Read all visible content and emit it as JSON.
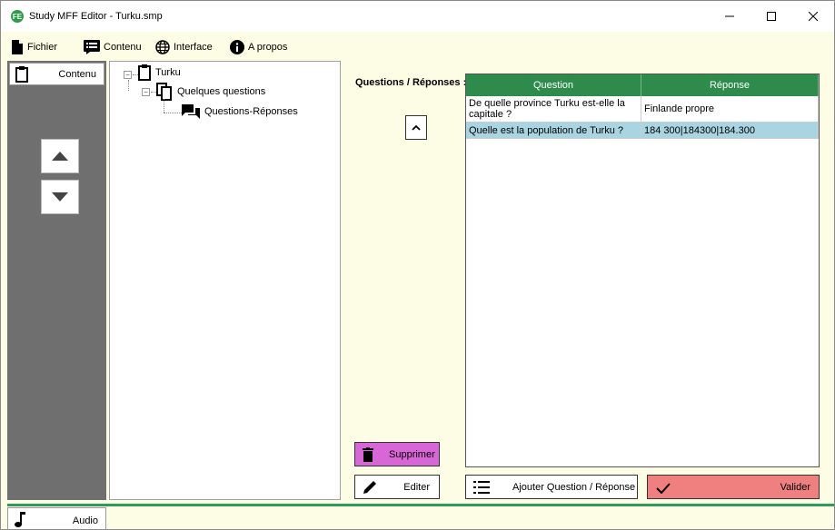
{
  "window": {
    "title": "Study MFF Editor - Turku.smp",
    "app_icon_text": "FE"
  },
  "menu": {
    "items": [
      {
        "label": "Fichier",
        "icon": "file-icon"
      },
      {
        "label": "Contenu",
        "icon": "list-icon"
      },
      {
        "label": "Interface",
        "icon": "globe-icon"
      },
      {
        "label": "A propos",
        "icon": "info-icon"
      }
    ]
  },
  "sidebar": {
    "tab_label": "Contenu",
    "bottom_tab_label": "Audio"
  },
  "tree": {
    "root": "Turku",
    "child": "Quelques questions",
    "leaf": "Questions-Réponses"
  },
  "main": {
    "label": "Questions / Réponses :",
    "grid": {
      "columns": [
        "Question",
        "Réponse"
      ],
      "rows": [
        {
          "question": "De quelle province Turku est-elle la capitale ?",
          "answer": "Finlande propre"
        },
        {
          "question": "Quelle est la population de Turku ?",
          "answer": "184 300|184300|184.300"
        }
      ]
    },
    "buttons": {
      "delete": "Supprimer",
      "edit": "Editer",
      "add": "Ajouter Question / Réponse",
      "validate": "Valider"
    }
  },
  "colors": {
    "accent_green": "#2e8b4c",
    "selection": "#a9d4e2",
    "delete_button": "#d966d6",
    "validate_button": "#f08080",
    "background": "#fdfde6"
  }
}
